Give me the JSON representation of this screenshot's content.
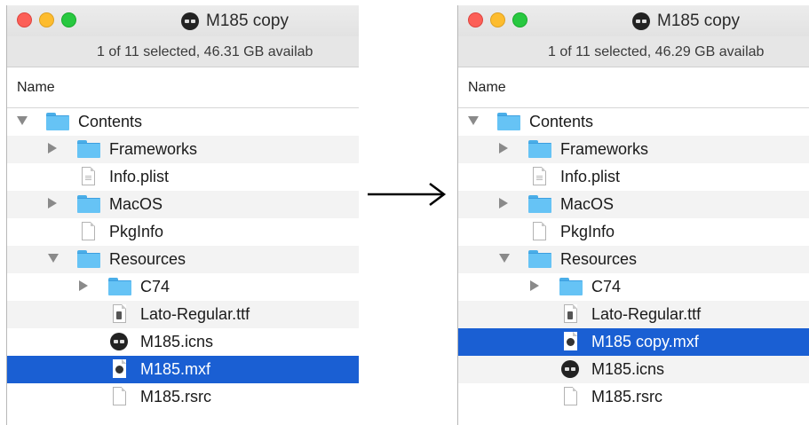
{
  "left_window": {
    "title": "M185 copy",
    "status": "1 of 11 selected, 46.31 GB availab",
    "column_header": "Name",
    "rows": [
      {
        "label": "Contents",
        "kind": "folder",
        "depth": 0,
        "disclosure": "open"
      },
      {
        "label": "Frameworks",
        "kind": "folder",
        "depth": 1,
        "disclosure": "closed"
      },
      {
        "label": "Info.plist",
        "kind": "plist",
        "depth": 1,
        "disclosure": "none"
      },
      {
        "label": "MacOS",
        "kind": "folder",
        "depth": 1,
        "disclosure": "closed"
      },
      {
        "label": "PkgInfo",
        "kind": "file",
        "depth": 1,
        "disclosure": "none"
      },
      {
        "label": "Resources",
        "kind": "folder",
        "depth": 1,
        "disclosure": "open"
      },
      {
        "label": "C74",
        "kind": "folder",
        "depth": 2,
        "disclosure": "closed"
      },
      {
        "label": "Lato-Regular.ttf",
        "kind": "font",
        "depth": 2,
        "disclosure": "none"
      },
      {
        "label": "M185.icns",
        "kind": "icns",
        "depth": 2,
        "disclosure": "none"
      },
      {
        "label": "M185.mxf",
        "kind": "mxf",
        "depth": 2,
        "disclosure": "none",
        "selected": true
      },
      {
        "label": "M185.rsrc",
        "kind": "file",
        "depth": 2,
        "disclosure": "none"
      }
    ]
  },
  "right_window": {
    "title": "M185 copy",
    "status": "1 of 11 selected, 46.29 GB availab",
    "column_header": "Name",
    "rows": [
      {
        "label": "Contents",
        "kind": "folder",
        "depth": 0,
        "disclosure": "open"
      },
      {
        "label": "Frameworks",
        "kind": "folder",
        "depth": 1,
        "disclosure": "closed"
      },
      {
        "label": "Info.plist",
        "kind": "plist",
        "depth": 1,
        "disclosure": "none"
      },
      {
        "label": "MacOS",
        "kind": "folder",
        "depth": 1,
        "disclosure": "closed"
      },
      {
        "label": "PkgInfo",
        "kind": "file",
        "depth": 1,
        "disclosure": "none"
      },
      {
        "label": "Resources",
        "kind": "folder",
        "depth": 1,
        "disclosure": "open"
      },
      {
        "label": "C74",
        "kind": "folder",
        "depth": 2,
        "disclosure": "closed"
      },
      {
        "label": "Lato-Regular.ttf",
        "kind": "font",
        "depth": 2,
        "disclosure": "none"
      },
      {
        "label": "M185 copy.mxf",
        "kind": "mxf",
        "depth": 2,
        "disclosure": "none",
        "selected": true
      },
      {
        "label": "M185.icns",
        "kind": "icns",
        "depth": 2,
        "disclosure": "none"
      },
      {
        "label": "M185.rsrc",
        "kind": "file",
        "depth": 2,
        "disclosure": "none"
      }
    ]
  },
  "colors": {
    "selection": "#1a5fd3",
    "folder": "#66c3f5",
    "close": "#fc5f57",
    "minimize": "#fdbc2e",
    "zoom": "#28c840"
  },
  "icons": {
    "arrow": "right-arrow-icon",
    "folder": "folder-icon",
    "disk": "disk-icon",
    "disclosure": "disclosure-triangle-icon"
  }
}
